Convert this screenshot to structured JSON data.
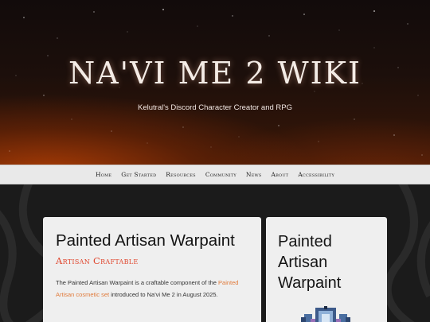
{
  "hero": {
    "title": "NA'VI ME 2 WIKI",
    "subtitle": "Kelutral's Discord Character Creator and RPG"
  },
  "nav": {
    "items": [
      "Home",
      "Get Started",
      "Resources",
      "Community",
      "News",
      "About",
      "Accessibility"
    ]
  },
  "main": {
    "title": "Painted Artisan Warpaint",
    "tag": "Artisan Craftable",
    "body_pre": "The Painted Artisan Warpaint is a craftable component of the ",
    "body_link": "Painted Artisan cosmetic set",
    "body_post": " introduced to Na'vi Me 2 in August 2025."
  },
  "sidebar": {
    "title": "Painted Artisan Warpaint",
    "image_icon": "warpaint-sprite-icon"
  },
  "colors": {
    "accent": "#e0442b",
    "link": "#e07a3a",
    "nav_bg": "#e9e9e9",
    "card_bg": "#efefef",
    "page_bg": "#1b1b1b"
  }
}
